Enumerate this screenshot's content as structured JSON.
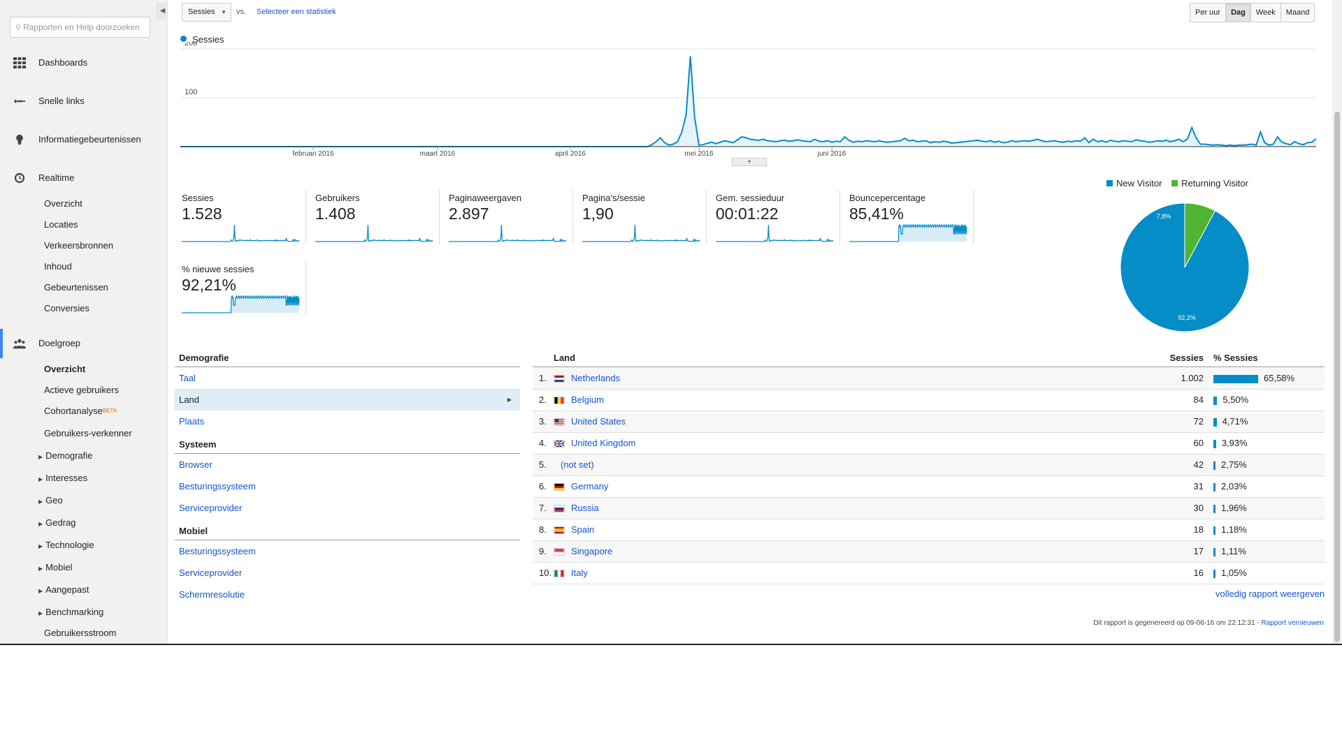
{
  "sidebar": {
    "search_placeholder": "Rapporten en Help doorzoeken",
    "main_items": [
      {
        "label": "Dashboards",
        "icon": "dashboard-grid-icon"
      },
      {
        "label": "Snelle links",
        "icon": "shortcut-arrow-icon"
      },
      {
        "label": "Informatiegebeurtenissen",
        "icon": "lightbulb-icon"
      },
      {
        "label": "Realtime",
        "icon": "clock-icon"
      }
    ],
    "realtime_sub": [
      "Overzicht",
      "Locaties",
      "Verkeersbronnen",
      "Inhoud",
      "Gebeurtenissen",
      "Conversies"
    ],
    "audience": {
      "label": "Doelgroep",
      "icon": "people-icon"
    },
    "audience_sub": {
      "overzicht": "Overzicht",
      "actieve": "Actieve gebruikers",
      "cohort": "Cohortanalyse",
      "cohort_badge": "BETA",
      "verkenner": "Gebruikers-verkenner",
      "expandable": [
        "Demografie",
        "Interesses",
        "Geo",
        "Gedrag",
        "Technologie",
        "Mobiel",
        "Aangepast",
        "Benchmarking"
      ],
      "flow": "Gebruikersstroom"
    }
  },
  "toolbar": {
    "metric_select": "Sessies",
    "vs_label": "vs.",
    "select_stat_link": "Selecteer een statistiek",
    "periods": [
      "Per uur",
      "Dag",
      "Week",
      "Maand"
    ],
    "active_period": "Dag"
  },
  "chart_data": [
    {
      "type": "line",
      "series": [
        {
          "name": "Sessies",
          "color": "#058dc7",
          "values": [
            0,
            0,
            0,
            0,
            0,
            0,
            0,
            0,
            0,
            0,
            0,
            0,
            0,
            0,
            0,
            0,
            0,
            0,
            0,
            0,
            0,
            0,
            0,
            0,
            0,
            0,
            0,
            0,
            0,
            0,
            0,
            0,
            0,
            0,
            0,
            0,
            0,
            0,
            0,
            0,
            0,
            0,
            0,
            0,
            0,
            0,
            0,
            0,
            0,
            0,
            0,
            0,
            0,
            0,
            0,
            0,
            0,
            0,
            0,
            0,
            0,
            0,
            0,
            0,
            0,
            0,
            0,
            0,
            0,
            0,
            0,
            0,
            0,
            0,
            0,
            0,
            0,
            0,
            0,
            0,
            0,
            0,
            0,
            0,
            0,
            0,
            0,
            0,
            0,
            0,
            0,
            0,
            0,
            0,
            0,
            0,
            0,
            0,
            0,
            0,
            0,
            0,
            0,
            0,
            0,
            0,
            0,
            0,
            0,
            0,
            4,
            10,
            18,
            8,
            3,
            5,
            10,
            30,
            65,
            185,
            60,
            3,
            4,
            7,
            9,
            6,
            9,
            12,
            10,
            8,
            14,
            20,
            18,
            15,
            14,
            13,
            15,
            12,
            11,
            10,
            12,
            13,
            11,
            12,
            14,
            12,
            11,
            10,
            15,
            11,
            10,
            12,
            9,
            11,
            10,
            20,
            13,
            9,
            11,
            10,
            12,
            11,
            10,
            12,
            10,
            9,
            10,
            11,
            12,
            17,
            12,
            13,
            10,
            11,
            12,
            8,
            10,
            9,
            11,
            10,
            7,
            8,
            9,
            10,
            11,
            12,
            13,
            11,
            10,
            12,
            9,
            11,
            8,
            9,
            12,
            10,
            11,
            12,
            11,
            13,
            15,
            12,
            10,
            11,
            12,
            10,
            9,
            11,
            10,
            12,
            11,
            18,
            8,
            15,
            10,
            12,
            9,
            13,
            11,
            10,
            12,
            11,
            10,
            14,
            12,
            11,
            9,
            10,
            12,
            11,
            13,
            10,
            12,
            15,
            10,
            16,
            39,
            18,
            5,
            5,
            4,
            3,
            4,
            3,
            2,
            3,
            2,
            3,
            3,
            4,
            5,
            3,
            30,
            8,
            3,
            5,
            20,
            9,
            6,
            4,
            10,
            6,
            4,
            8,
            9,
            16
          ]
        }
      ],
      "x_tick_labels": [
        "februari 2016",
        "maart 2016",
        "april 2016",
        "mei 2016",
        "juni 2016"
      ],
      "y_tick_labels": [
        "100",
        "200"
      ],
      "ylim": [
        0,
        200
      ]
    },
    {
      "type": "pie",
      "series": [
        {
          "name": "New Visitor",
          "value": 92.2,
          "label": "92,2%",
          "color": "#058dc7"
        },
        {
          "name": "Returning Visitor",
          "value": 7.8,
          "label": "7,8%",
          "color": "#50b432"
        }
      ]
    }
  ],
  "scorecards": [
    {
      "label": "Sessies",
      "value": "1.528",
      "spark": "peak"
    },
    {
      "label": "Gebruikers",
      "value": "1.408",
      "spark": "peak"
    },
    {
      "label": "Paginaweergaven",
      "value": "2.897",
      "spark": "peak"
    },
    {
      "label": "Pagina's/sessie",
      "value": "1,90",
      "spark": "peak"
    },
    {
      "label": "Gem. sessieduur",
      "value": "00:01:22",
      "spark": "peak"
    },
    {
      "label": "Bouncepercentage",
      "value": "85,41%",
      "spark": "plateau"
    },
    {
      "label": "% nieuwe sessies",
      "value": "92,21%",
      "spark": "plateau"
    }
  ],
  "demografie": {
    "sections": [
      {
        "title": "Demografie",
        "links": [
          "Taal",
          "Land",
          "Plaats"
        ]
      },
      {
        "title": "Systeem",
        "links": [
          "Browser",
          "Besturingssysteem",
          "Serviceprovider"
        ]
      },
      {
        "title": "Mobiel",
        "links": [
          "Besturingssysteem",
          "Serviceprovider",
          "Schermresolutie"
        ]
      }
    ],
    "selected": "Land"
  },
  "land_table": {
    "headers": {
      "land": "Land",
      "sessions": "Sessies",
      "pct": "% Sessies"
    },
    "rows": [
      {
        "rank": "1.",
        "country": "Netherlands",
        "flag": "nl",
        "sessions": "1.002",
        "pct": "65,58%",
        "share": 65.58
      },
      {
        "rank": "2.",
        "country": "Belgium",
        "flag": "be",
        "sessions": "84",
        "pct": "5,50%",
        "share": 5.5
      },
      {
        "rank": "3.",
        "country": "United States",
        "flag": "us",
        "sessions": "72",
        "pct": "4,71%",
        "share": 4.71
      },
      {
        "rank": "4.",
        "country": "United Kingdom",
        "flag": "gb",
        "sessions": "60",
        "pct": "3,93%",
        "share": 3.93
      },
      {
        "rank": "5.",
        "country": "(not set)",
        "flag": "",
        "sessions": "42",
        "pct": "2,75%",
        "share": 2.75
      },
      {
        "rank": "6.",
        "country": "Germany",
        "flag": "de",
        "sessions": "31",
        "pct": "2,03%",
        "share": 2.03
      },
      {
        "rank": "7.",
        "country": "Russia",
        "flag": "ru",
        "sessions": "30",
        "pct": "1,96%",
        "share": 1.96
      },
      {
        "rank": "8.",
        "country": "Spain",
        "flag": "es",
        "sessions": "18",
        "pct": "1,18%",
        "share": 1.18
      },
      {
        "rank": "9.",
        "country": "Singapore",
        "flag": "sg",
        "sessions": "17",
        "pct": "1,11%",
        "share": 1.11
      },
      {
        "rank": "10.",
        "country": "Italy",
        "flag": "it",
        "sessions": "16",
        "pct": "1,05%",
        "share": 1.05
      }
    ],
    "full_report_link": "volledig rapport weergeven"
  },
  "footer": {
    "generated_text": "Dit rapport is gegenereerd op 09-06-16 om 22:12:31 - ",
    "refresh_link": "Rapport vernieuwen"
  }
}
